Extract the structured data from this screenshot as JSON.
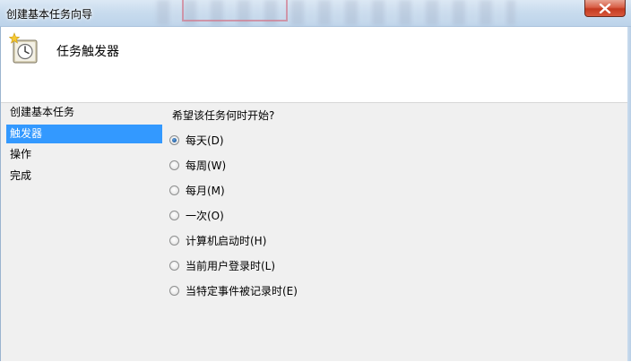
{
  "window": {
    "title": "创建基本任务向导",
    "close_icon": "close-x-icon",
    "accent_close": "#c43a20"
  },
  "header": {
    "icon": "task-clock-icon",
    "title": "任务触发器"
  },
  "sidebar": {
    "selected_color": "#3399ff",
    "items": [
      {
        "label": "创建基本任务"
      },
      {
        "label": "触发器"
      },
      {
        "label": "操作"
      },
      {
        "label": "完成"
      }
    ]
  },
  "main": {
    "question": "希望该任务何时开始?",
    "options": [
      {
        "label": "每天(D)",
        "checked": true
      },
      {
        "label": "每周(W)",
        "checked": false
      },
      {
        "label": "每月(M)",
        "checked": false
      },
      {
        "label": "一次(O)",
        "checked": false
      },
      {
        "label": "计算机启动时(H)",
        "checked": false
      },
      {
        "label": "当前用户登录时(L)",
        "checked": false
      },
      {
        "label": "当特定事件被记录时(E)",
        "checked": false
      }
    ]
  }
}
